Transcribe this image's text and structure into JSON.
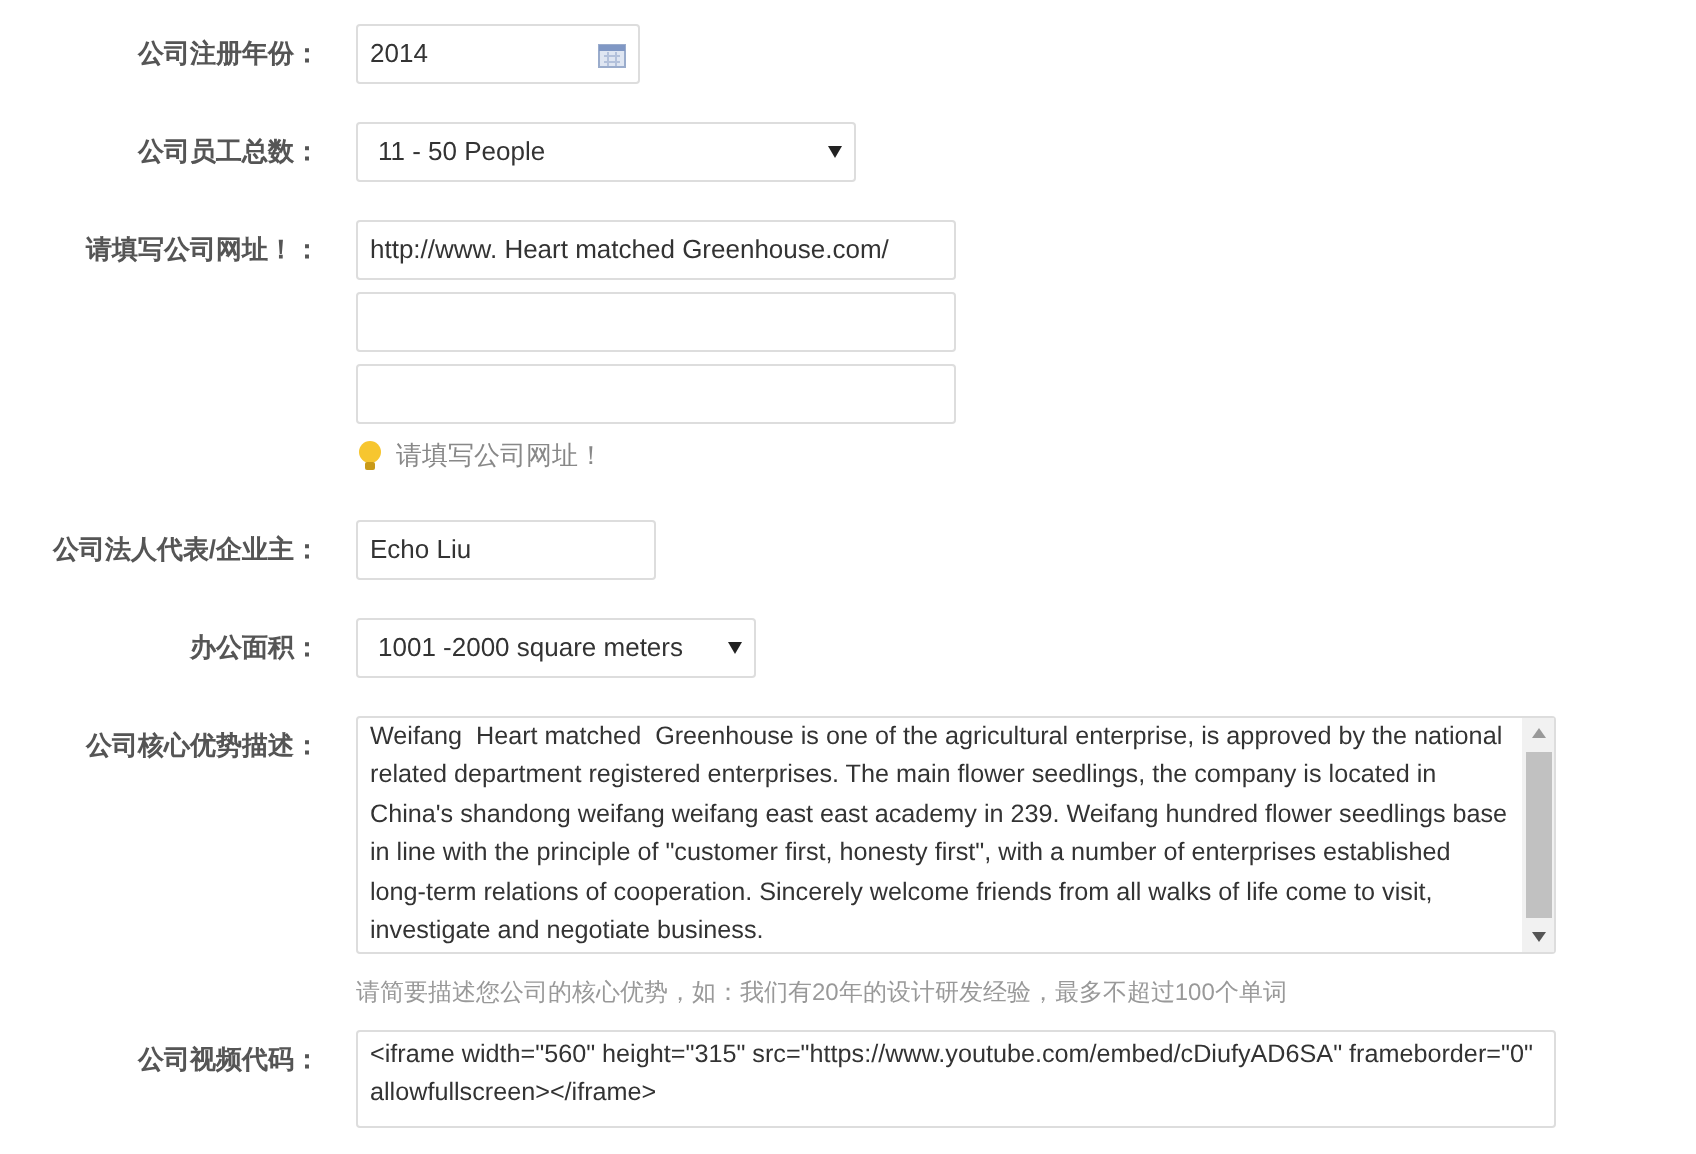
{
  "fields": [
    {
      "label": "公司注册年份：",
      "kind": "date",
      "value": "2014"
    },
    {
      "label": "公司员工总数：",
      "kind": "select",
      "value": "11 - 50 People"
    },
    {
      "label": "请填写公司网址！：",
      "kind": "multi",
      "inputs": [
        {
          "kind": "filled",
          "value": "http://www. Heart matched  Greenhouse.com/"
        },
        {
          "kind": "blank"
        },
        {
          "kind": "blank"
        }
      ],
      "hint": "请填写公司网址！"
    },
    {
      "label": "公司法人代表/企业主：",
      "kind": "text",
      "value": "Echo Liu"
    },
    {
      "label": "办公面积：",
      "kind": "select",
      "value": "1001 -2000 square meters"
    },
    {
      "label": "公司核心优势描述：",
      "kind": "textarea",
      "scroll": true,
      "value": "Weifang  Heart matched  Greenhouse is one of the agricultural enterprise, is approved by the national related department registered enterprises. The main flower seedlings, the company is located in China's shandong weifang weifang east east academy in 239. Weifang hundred flower seedlings base in line with the principle of \"customer first, honesty first\", with a number of enterprises established long-term relations of cooperation. Sincerely welcome friends from all walks of life come to visit, investigate and negotiate business.",
      "note": "请简要描述您公司的核心优势，如：我们有20年的设计研发经验，最多不超过100个单词"
    },
    {
      "label": "公司视频代码：",
      "kind": "textarea",
      "scroll": false,
      "value": "<iframe width=\"560\" height=\"315\" src=\"https://www.youtube.com/embed/cDiufyAD6SA\" frameborder=\"0\" allowfullscreen></iframe>"
    }
  ]
}
